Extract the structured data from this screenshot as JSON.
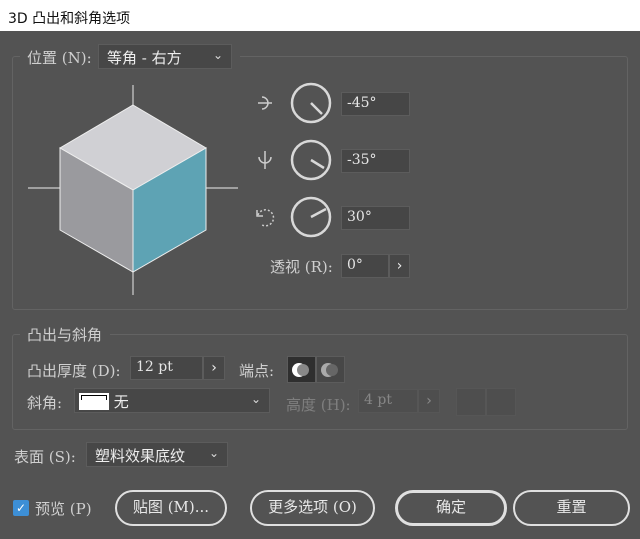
{
  "title": "3D 凸出和斜角选项",
  "position": {
    "label": "位置 (N):",
    "value": "等角 - 右方"
  },
  "rotation": {
    "x": "-45°",
    "y": "-35°",
    "z": "30°"
  },
  "perspective": {
    "label": "透视 (R):",
    "value": "0°"
  },
  "extrude": {
    "group_label": "凸出与斜角",
    "depth_label": "凸出厚度 (D):",
    "depth_value": "12 pt",
    "cap_label": "端点:",
    "bevel_label": "斜角:",
    "bevel_value": "无",
    "height_label": "高度 (H):",
    "height_value": "4 pt"
  },
  "surface": {
    "label": "表面 (S):",
    "value": "塑料效果底纹"
  },
  "footer": {
    "preview_label": "预览 (P)",
    "map_label": "贴图 (M)...",
    "more_label": "更多选项 (O)",
    "ok_label": "确定",
    "reset_label": "重置"
  },
  "colors": {
    "cube_top": "#d0d0d4",
    "cube_left": "#9a9a9e",
    "cube_right": "#5ea3b4",
    "checkbox": "#3d8fd6"
  }
}
